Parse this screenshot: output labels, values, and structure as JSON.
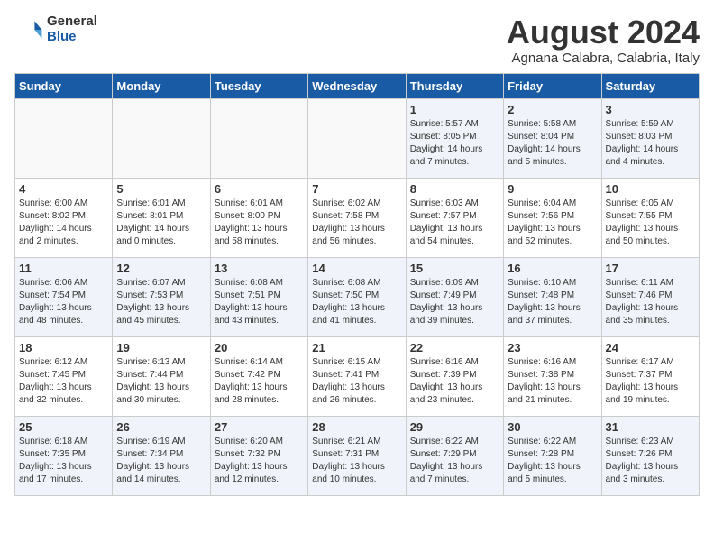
{
  "logo": {
    "general": "General",
    "blue": "Blue"
  },
  "title": "August 2024",
  "location": "Agnana Calabra, Calabria, Italy",
  "days_of_week": [
    "Sunday",
    "Monday",
    "Tuesday",
    "Wednesday",
    "Thursday",
    "Friday",
    "Saturday"
  ],
  "weeks": [
    [
      {
        "day": "",
        "info": ""
      },
      {
        "day": "",
        "info": ""
      },
      {
        "day": "",
        "info": ""
      },
      {
        "day": "",
        "info": ""
      },
      {
        "day": "1",
        "info": "Sunrise: 5:57 AM\nSunset: 8:05 PM\nDaylight: 14 hours\nand 7 minutes."
      },
      {
        "day": "2",
        "info": "Sunrise: 5:58 AM\nSunset: 8:04 PM\nDaylight: 14 hours\nand 5 minutes."
      },
      {
        "day": "3",
        "info": "Sunrise: 5:59 AM\nSunset: 8:03 PM\nDaylight: 14 hours\nand 4 minutes."
      }
    ],
    [
      {
        "day": "4",
        "info": "Sunrise: 6:00 AM\nSunset: 8:02 PM\nDaylight: 14 hours\nand 2 minutes."
      },
      {
        "day": "5",
        "info": "Sunrise: 6:01 AM\nSunset: 8:01 PM\nDaylight: 14 hours\nand 0 minutes."
      },
      {
        "day": "6",
        "info": "Sunrise: 6:01 AM\nSunset: 8:00 PM\nDaylight: 13 hours\nand 58 minutes."
      },
      {
        "day": "7",
        "info": "Sunrise: 6:02 AM\nSunset: 7:58 PM\nDaylight: 13 hours\nand 56 minutes."
      },
      {
        "day": "8",
        "info": "Sunrise: 6:03 AM\nSunset: 7:57 PM\nDaylight: 13 hours\nand 54 minutes."
      },
      {
        "day": "9",
        "info": "Sunrise: 6:04 AM\nSunset: 7:56 PM\nDaylight: 13 hours\nand 52 minutes."
      },
      {
        "day": "10",
        "info": "Sunrise: 6:05 AM\nSunset: 7:55 PM\nDaylight: 13 hours\nand 50 minutes."
      }
    ],
    [
      {
        "day": "11",
        "info": "Sunrise: 6:06 AM\nSunset: 7:54 PM\nDaylight: 13 hours\nand 48 minutes."
      },
      {
        "day": "12",
        "info": "Sunrise: 6:07 AM\nSunset: 7:53 PM\nDaylight: 13 hours\nand 45 minutes."
      },
      {
        "day": "13",
        "info": "Sunrise: 6:08 AM\nSunset: 7:51 PM\nDaylight: 13 hours\nand 43 minutes."
      },
      {
        "day": "14",
        "info": "Sunrise: 6:08 AM\nSunset: 7:50 PM\nDaylight: 13 hours\nand 41 minutes."
      },
      {
        "day": "15",
        "info": "Sunrise: 6:09 AM\nSunset: 7:49 PM\nDaylight: 13 hours\nand 39 minutes."
      },
      {
        "day": "16",
        "info": "Sunrise: 6:10 AM\nSunset: 7:48 PM\nDaylight: 13 hours\nand 37 minutes."
      },
      {
        "day": "17",
        "info": "Sunrise: 6:11 AM\nSunset: 7:46 PM\nDaylight: 13 hours\nand 35 minutes."
      }
    ],
    [
      {
        "day": "18",
        "info": "Sunrise: 6:12 AM\nSunset: 7:45 PM\nDaylight: 13 hours\nand 32 minutes."
      },
      {
        "day": "19",
        "info": "Sunrise: 6:13 AM\nSunset: 7:44 PM\nDaylight: 13 hours\nand 30 minutes."
      },
      {
        "day": "20",
        "info": "Sunrise: 6:14 AM\nSunset: 7:42 PM\nDaylight: 13 hours\nand 28 minutes."
      },
      {
        "day": "21",
        "info": "Sunrise: 6:15 AM\nSunset: 7:41 PM\nDaylight: 13 hours\nand 26 minutes."
      },
      {
        "day": "22",
        "info": "Sunrise: 6:16 AM\nSunset: 7:39 PM\nDaylight: 13 hours\nand 23 minutes."
      },
      {
        "day": "23",
        "info": "Sunrise: 6:16 AM\nSunset: 7:38 PM\nDaylight: 13 hours\nand 21 minutes."
      },
      {
        "day": "24",
        "info": "Sunrise: 6:17 AM\nSunset: 7:37 PM\nDaylight: 13 hours\nand 19 minutes."
      }
    ],
    [
      {
        "day": "25",
        "info": "Sunrise: 6:18 AM\nSunset: 7:35 PM\nDaylight: 13 hours\nand 17 minutes."
      },
      {
        "day": "26",
        "info": "Sunrise: 6:19 AM\nSunset: 7:34 PM\nDaylight: 13 hours\nand 14 minutes."
      },
      {
        "day": "27",
        "info": "Sunrise: 6:20 AM\nSunset: 7:32 PM\nDaylight: 13 hours\nand 12 minutes."
      },
      {
        "day": "28",
        "info": "Sunrise: 6:21 AM\nSunset: 7:31 PM\nDaylight: 13 hours\nand 10 minutes."
      },
      {
        "day": "29",
        "info": "Sunrise: 6:22 AM\nSunset: 7:29 PM\nDaylight: 13 hours\nand 7 minutes."
      },
      {
        "day": "30",
        "info": "Sunrise: 6:22 AM\nSunset: 7:28 PM\nDaylight: 13 hours\nand 5 minutes."
      },
      {
        "day": "31",
        "info": "Sunrise: 6:23 AM\nSunset: 7:26 PM\nDaylight: 13 hours\nand 3 minutes."
      }
    ]
  ]
}
